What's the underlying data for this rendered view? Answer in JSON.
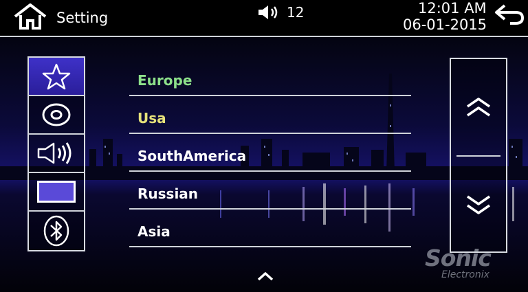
{
  "header": {
    "title": "Setting",
    "volume": "12",
    "time": "12:01 AM",
    "date": "06-01-2015",
    "icons": {
      "home": "home-icon",
      "volume": "speaker-icon",
      "back": "back-arrow-icon"
    }
  },
  "sidebar": {
    "items": [
      {
        "icon": "star-icon",
        "active": true
      },
      {
        "icon": "disc-icon",
        "active": false
      },
      {
        "icon": "speaker-icon",
        "active": false
      },
      {
        "icon": "display-icon",
        "active": false
      },
      {
        "icon": "bluetooth-icon",
        "active": false
      }
    ]
  },
  "list": {
    "items": [
      {
        "label": "Europe",
        "color": "#8de08a"
      },
      {
        "label": "Usa",
        "color": "#e6e27a"
      },
      {
        "label": "SouthAmerica",
        "color": "#ffffff"
      },
      {
        "label": "Russian",
        "color": "#ffffff"
      },
      {
        "label": "Asia",
        "color": "#ffffff"
      }
    ]
  },
  "scroll": {
    "up_icon": "double-chevron-up-icon",
    "down_icon": "double-chevron-down-icon"
  },
  "watermark": {
    "brand": "Sonic",
    "sub": "Electronix"
  },
  "colors": {
    "accent": "#2f22b0",
    "divider": "#cfd3da"
  }
}
